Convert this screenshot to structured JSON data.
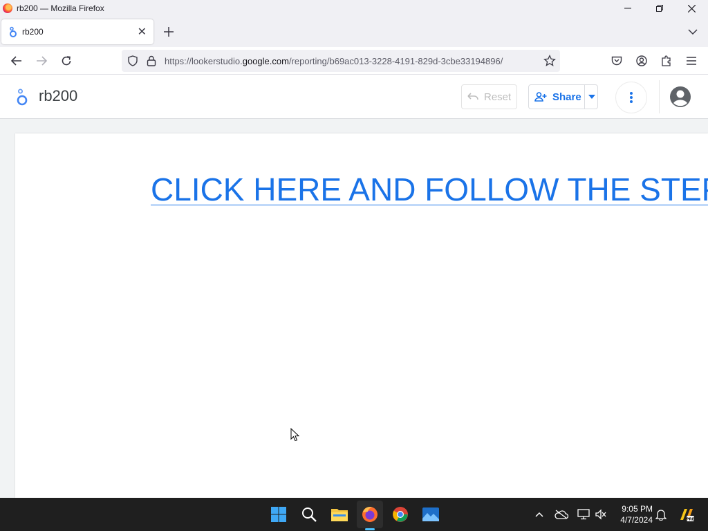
{
  "window": {
    "title": "rb200 — Mozilla Firefox",
    "controls": [
      "minimize-icon",
      "restore-icon",
      "close-icon"
    ]
  },
  "tabs": [
    {
      "label": "rb200",
      "icon": "looker-studio-icon"
    }
  ],
  "navbar": {
    "url_prefix": "https://lookerstudio.",
    "url_domain": "google.com",
    "url_path": "/reporting/b69ac013-3228-4191-829d-3cbe33194896/"
  },
  "app": {
    "title": "rb200",
    "reset_label": "Reset",
    "share_label": "Share",
    "accent": "#1a73e8"
  },
  "report": {
    "link_text": "CLICK HERE AND FOLLOW THE STEPS"
  },
  "taskbar": {
    "apps": [
      "windows-start-icon",
      "search-icon",
      "file-explorer-icon",
      "firefox-icon",
      "chrome-icon",
      "photos-icon"
    ],
    "time": "9:05 PM",
    "date": "4/7/2024"
  }
}
